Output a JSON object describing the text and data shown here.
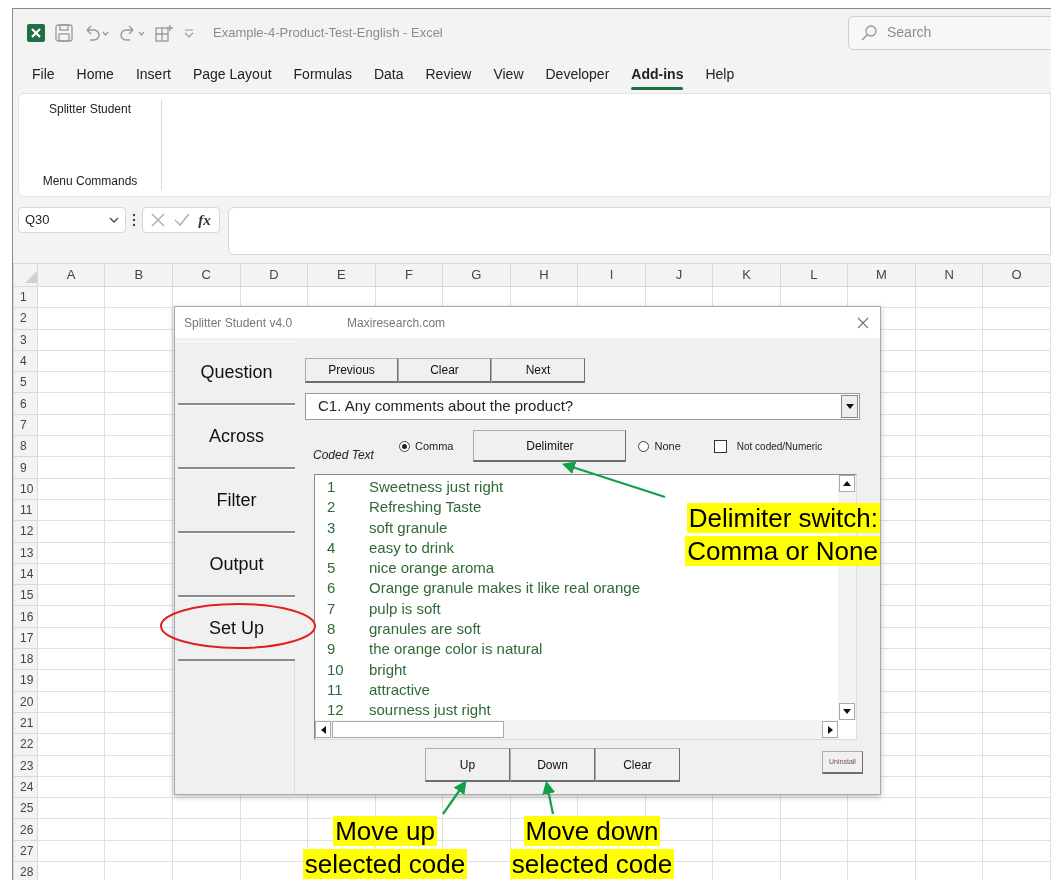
{
  "window": {
    "title": "Example-4-Product-Test-English  -  Excel",
    "search_placeholder": "Search"
  },
  "menu_tabs": [
    {
      "label": "File",
      "selected": false
    },
    {
      "label": "Home",
      "selected": false
    },
    {
      "label": "Insert",
      "selected": false
    },
    {
      "label": "Page Layout",
      "selected": false
    },
    {
      "label": "Formulas",
      "selected": false
    },
    {
      "label": "Data",
      "selected": false
    },
    {
      "label": "Review",
      "selected": false
    },
    {
      "label": "View",
      "selected": false
    },
    {
      "label": "Developer",
      "selected": false
    },
    {
      "label": "Add-ins",
      "selected": true
    },
    {
      "label": "Help",
      "selected": false
    }
  ],
  "ribbon": {
    "command": "Splitter Student",
    "group_label": "Menu Commands"
  },
  "formula_bar": {
    "name_box": "Q30",
    "fx_label": "fx"
  },
  "sheet": {
    "columns": [
      "A",
      "B",
      "C",
      "D",
      "E",
      "F",
      "G",
      "H",
      "I",
      "J",
      "K",
      "L",
      "M",
      "N",
      "O"
    ],
    "rows": [
      "1",
      "2",
      "3",
      "4",
      "5",
      "6",
      "7",
      "8",
      "9",
      "10",
      "11",
      "12",
      "13",
      "14",
      "15",
      "16",
      "17",
      "18",
      "19",
      "20",
      "21",
      "22",
      "23",
      "24",
      "25",
      "26",
      "27",
      "28"
    ]
  },
  "dialog": {
    "title": "Splitter Student v4.0",
    "subtitle": "Maxiresearch.com",
    "side_tabs": [
      "Question",
      "Across",
      "Filter",
      "Output",
      "Set Up"
    ],
    "nav_buttons": [
      "Previous",
      "Clear",
      "Next"
    ],
    "question_select": {
      "value": "C1. Any comments about the product?"
    },
    "coded_text_label": "Coded Text",
    "delimiter_options": [
      {
        "label": "Comma",
        "selected": true
      },
      {
        "label": "None",
        "selected": false
      }
    ],
    "delimiter_button": "Delimiter",
    "not_coded": {
      "label": "Not coded/Numeric",
      "checked": false
    },
    "codes": [
      {
        "number": "1",
        "text": "Sweetness just right"
      },
      {
        "number": "2",
        "text": "Refreshing Taste"
      },
      {
        "number": "3",
        "text": "soft granule"
      },
      {
        "number": "4",
        "text": "easy to drink"
      },
      {
        "number": "5",
        "text": "nice orange aroma"
      },
      {
        "number": "6",
        "text": "Orange granule makes it like real orange"
      },
      {
        "number": "7",
        "text": "pulp is soft"
      },
      {
        "number": "8",
        "text": "granules are soft"
      },
      {
        "number": "9",
        "text": "the orange color is natural"
      },
      {
        "number": "10",
        "text": "bright"
      },
      {
        "number": "11",
        "text": "attractive"
      },
      {
        "number": "12",
        "text": "sourness just right"
      }
    ],
    "move_buttons": [
      "Up",
      "Down",
      "Clear"
    ],
    "uninstall_button": "Uninstall"
  },
  "callouts": [
    {
      "lines": [
        "Delimiter switch:",
        "Comma or None"
      ]
    },
    {
      "lines": [
        "Move up",
        "selected code"
      ]
    },
    {
      "lines": [
        "Move down",
        "selected code"
      ]
    }
  ]
}
